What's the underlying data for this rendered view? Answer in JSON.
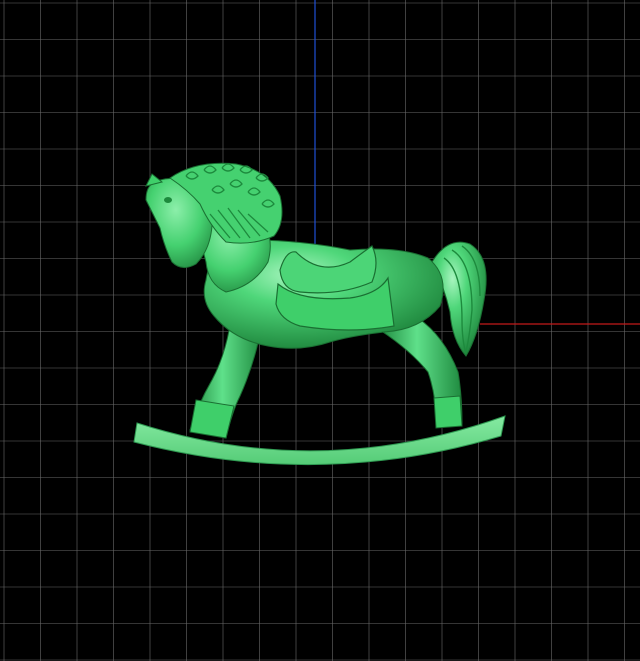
{
  "viewport": {
    "background": "#000000",
    "grid_color": "#6b6b6b",
    "axis_y_color": "#1f4fd6",
    "axis_x_color": "#c21a1a",
    "grid_visible": true
  },
  "model": {
    "object": "rocking-horse",
    "body_color": "#3fcf6a",
    "shadow_color": "#1d8a3d",
    "highlight_color": "#9af0b4",
    "rocker_color": "#6fe08f"
  }
}
